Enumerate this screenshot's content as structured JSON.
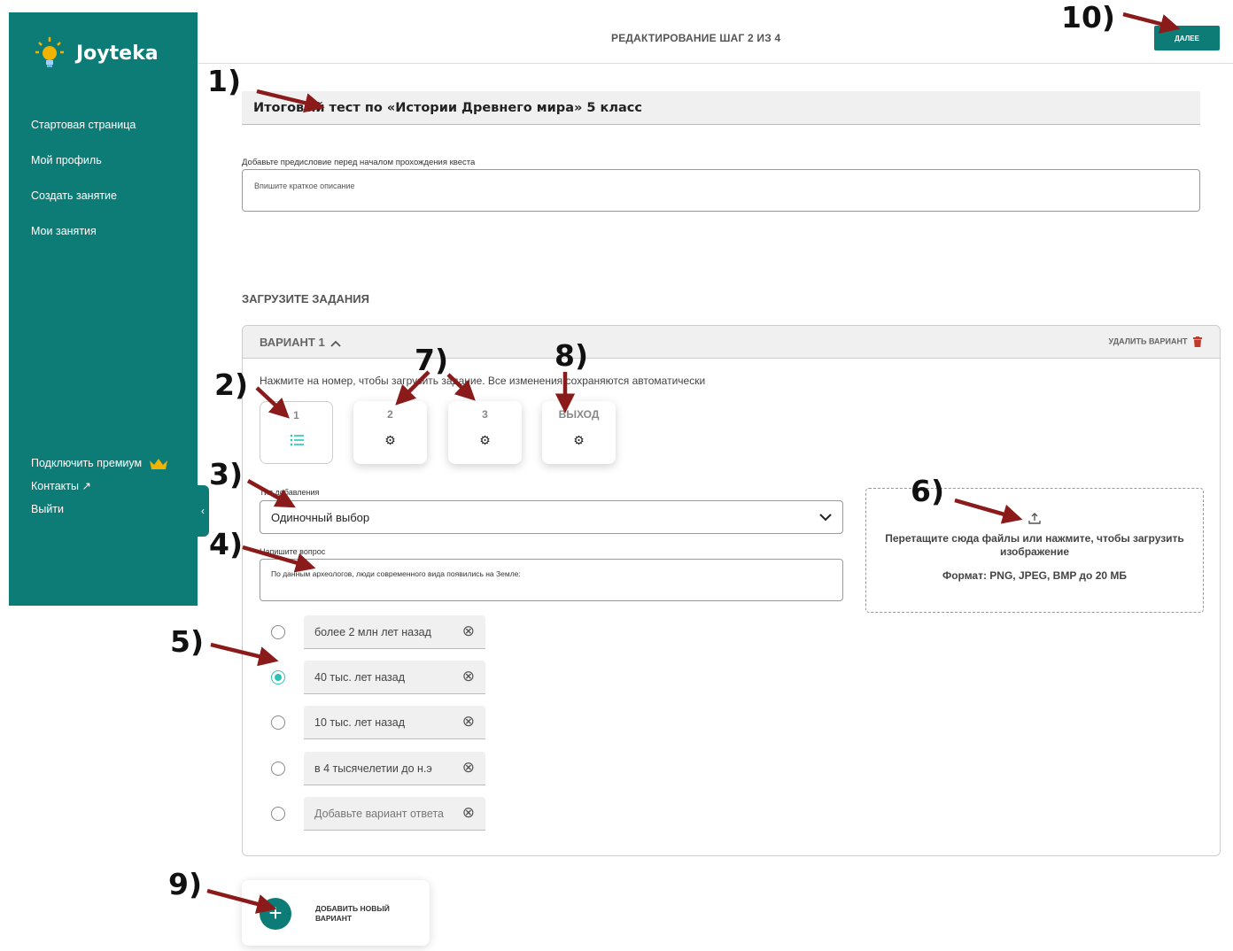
{
  "sidebar": {
    "logo_text": "Joyteka",
    "nav": [
      "Стартовая страница",
      "Мой профиль",
      "Создать занятие",
      "Мои занятия"
    ],
    "bottom": {
      "premium": "Подключить премиум",
      "contacts": "Контакты ↗",
      "logout": "Выйти"
    },
    "collapse_icon": "‹"
  },
  "header": {
    "step": "РЕДАКТИРОВАНИЕ ШАГ 2 ИЗ 4",
    "next_label": "ДАЛЕЕ"
  },
  "quest": {
    "title": "Итоговый тест по «Истории Древнего мира» 5 класс",
    "intro_label": "Добавьте предисловие перед началом прохождения квеста",
    "intro_placeholder": "Впишите краткое описание"
  },
  "tasks_heading": "ЗАГРУЗИТЕ ЗАДАНИЯ",
  "variant": {
    "name": "ВАРИАНТ 1",
    "delete_label": "УДАЛИТЬ ВАРИАНТ",
    "hint": "Нажмите на номер, чтобы загрузить задание. Все изменения сохраняются автоматически",
    "tasks": [
      {
        "label": "1",
        "icon": "list-icon"
      },
      {
        "label": "2",
        "icon": "gear-icon"
      },
      {
        "label": "3",
        "icon": "gear-icon"
      },
      {
        "label": "ВЫХОД",
        "icon": "gear-icon"
      }
    ],
    "type_label": "Тип добавления",
    "type_value": "Одиночный выбор",
    "question_label": "Напишите вопрос",
    "question_value": "По данным археологов, люди современного вида появились на Земле:",
    "answers": [
      {
        "text": "более 2 млн лет назад",
        "checked": false
      },
      {
        "text": "40 тыс. лет назад",
        "checked": true
      },
      {
        "text": "10 тыс. лет назад",
        "checked": false
      },
      {
        "text": "в 4 тысячелетии до н.э",
        "checked": false
      },
      {
        "text": "Добавьте вариант ответа",
        "checked": false,
        "placeholder": true
      }
    ],
    "dropzone": {
      "text": "Перетащите сюда файлы или нажмите, чтобы загрузить изображение",
      "format": "Формат: PNG, JPEG, BMP до 20 МБ"
    }
  },
  "add_variant_label": "ДОБАВИТЬ НОВЫЙ ВАРИАНТ",
  "annotations": [
    "1)",
    "2)",
    "3)",
    "4)",
    "5)",
    "6)",
    "7)",
    "8)",
    "9)",
    "10)"
  ],
  "colors": {
    "brand": "#0e7c76",
    "accent": "#2cc3b5",
    "arrow": "#8b1a1a",
    "delete": "#c0392b",
    "crown": "#f0b400"
  }
}
